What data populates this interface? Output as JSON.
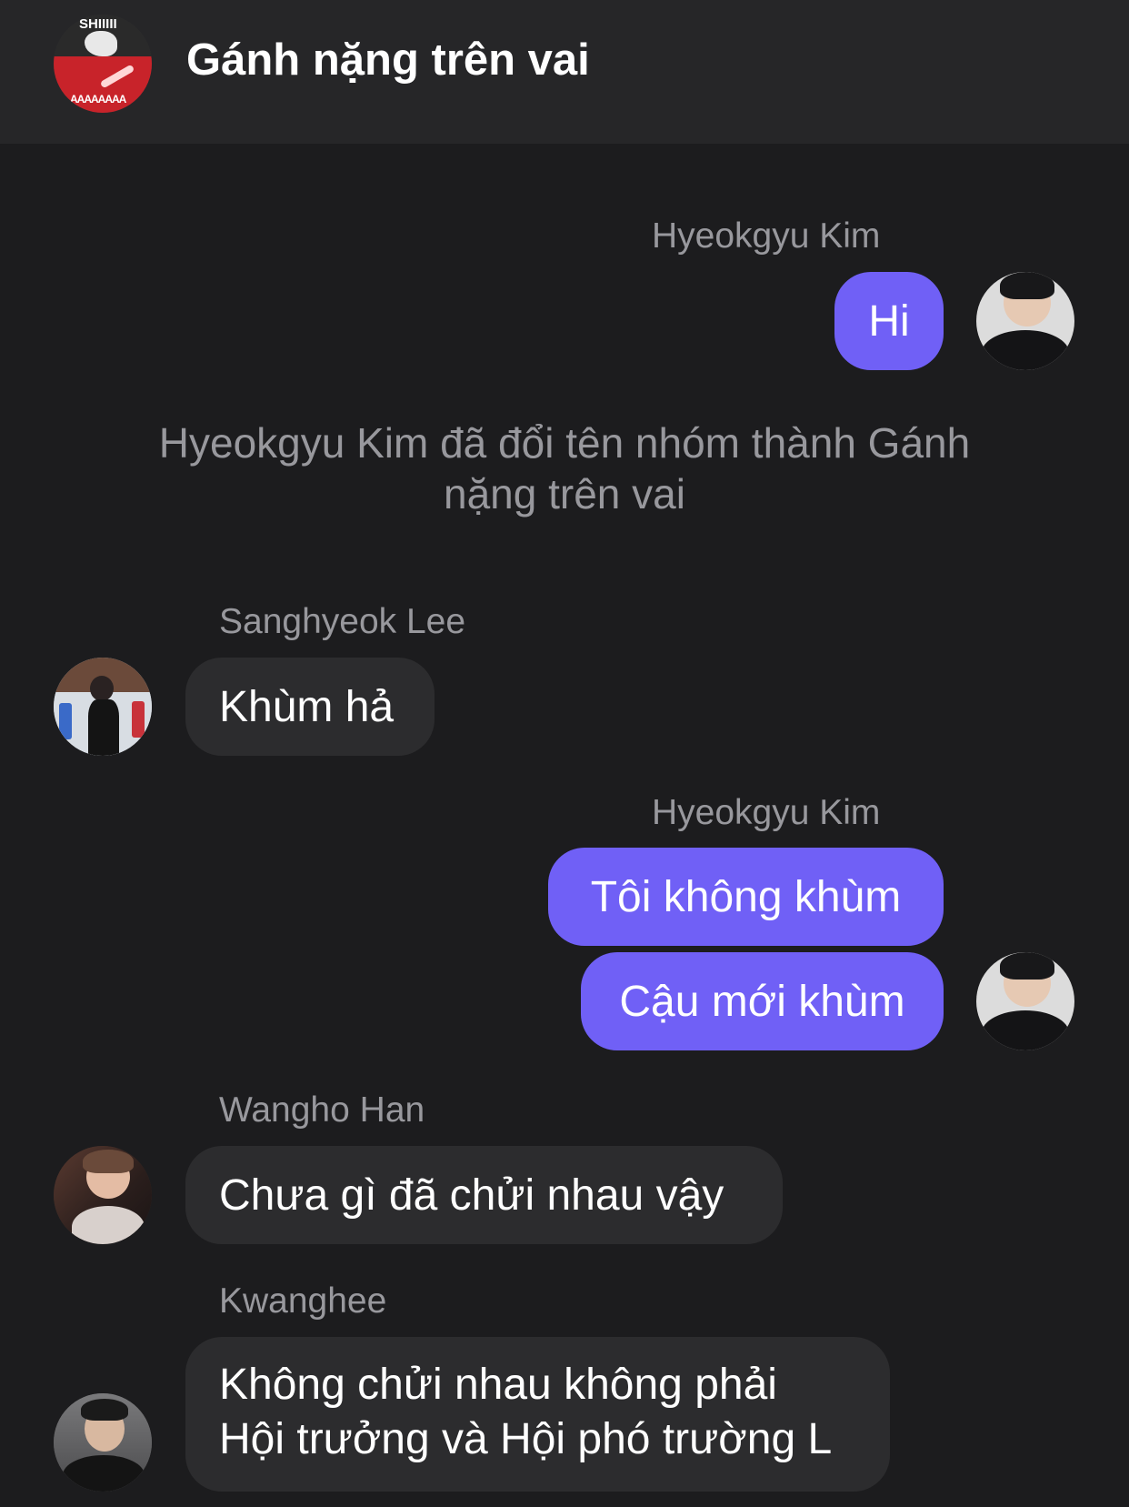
{
  "header": {
    "title": "Gánh nặng trên vai",
    "avatar_text_top": "SHIIIII",
    "avatar_text_bottom": "AAAAAAAA"
  },
  "messages": [
    {
      "sender": "Hyeokgyu Kim",
      "direction": "out",
      "text": "Hi"
    },
    {
      "system": "Hyeokgyu Kim đã đổi tên nhóm thành Gánh nặng trên vai"
    },
    {
      "sender": "Sanghyeok Lee",
      "direction": "in",
      "text": "Khùm hả"
    },
    {
      "sender": "Hyeokgyu Kim",
      "direction": "out",
      "text": "Tôi không khùm"
    },
    {
      "sender": "Hyeokgyu Kim",
      "direction": "out",
      "text": "Cậu mới khùm"
    },
    {
      "sender": "Wangho Han",
      "direction": "in",
      "text": "Chưa gì đã chửi nhau vậy"
    },
    {
      "sender": "Kwanghee",
      "direction": "in",
      "text_lines": [
        "Không chửi nhau không phải",
        "Hội trưởng và Hội phó trường L"
      ]
    }
  ],
  "colors": {
    "background": "#1c1c1e",
    "header": "#262628",
    "outgoing_bubble": "#7060f6",
    "incoming_bubble": "#2c2c2e",
    "secondary_text": "#98989d"
  }
}
